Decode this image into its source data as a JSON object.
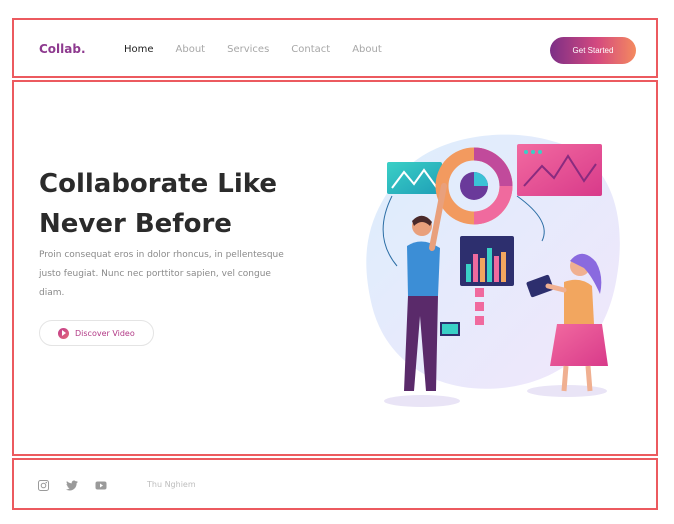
{
  "header": {
    "logo": "Collab.",
    "nav": [
      "Home",
      "About",
      "Services",
      "Contact",
      "About"
    ],
    "cta": "Get Started"
  },
  "hero": {
    "title_line1": "Collaborate Like",
    "title_line2": "Never Before",
    "description": "Proin consequat eros in dolor rhoncus, in pellentesque justo feugiat. Nunc nec porttitor sapien, vel congue diam.",
    "video_button": "Discover Video"
  },
  "footer": {
    "icons": [
      "instagram-icon",
      "twitter-icon",
      "youtube-icon"
    ],
    "text": "Thu Nghiem"
  },
  "colors": {
    "accent_start": "#7c2f86",
    "accent_end": "#f48a5f",
    "frame": "#ec5a5f"
  }
}
